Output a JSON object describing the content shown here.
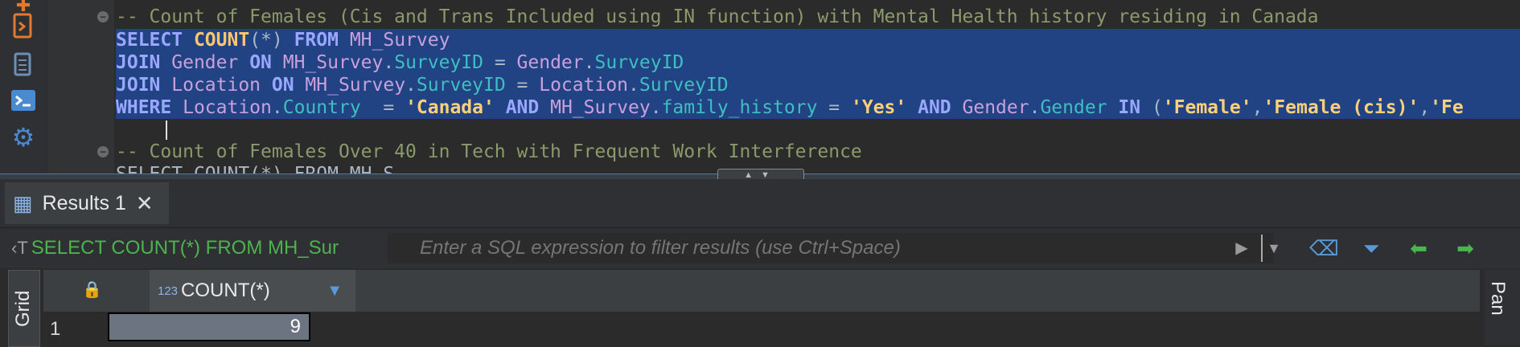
{
  "toolstrip": {
    "icons": [
      "plus-icon",
      "script-icon",
      "outline-icon",
      "console-icon",
      "settings-icon"
    ]
  },
  "editor": {
    "comment1": "-- Count of Females (Cis and Trans Included using IN function) with Mental Health history residing in Canada",
    "line_select": [
      {
        "t": "SELECT ",
        "c": "kwb"
      },
      {
        "t": "COUNT",
        "c": "fn"
      },
      {
        "t": "(*) ",
        "c": "pl"
      },
      {
        "t": "FROM ",
        "c": "kwb"
      },
      {
        "t": "MH_Survey",
        "c": "tbl"
      }
    ],
    "line_join1": [
      {
        "t": "JOIN ",
        "c": "kwb"
      },
      {
        "t": "Gender ",
        "c": "tbl"
      },
      {
        "t": "ON ",
        "c": "kwb"
      },
      {
        "t": "MH_Survey",
        "c": "tbl"
      },
      {
        "t": ".",
        "c": "pl"
      },
      {
        "t": "SurveyID",
        "c": "col"
      },
      {
        "t": " = ",
        "c": "pl"
      },
      {
        "t": "Gender",
        "c": "tbl"
      },
      {
        "t": ".",
        "c": "pl"
      },
      {
        "t": "SurveyID",
        "c": "col"
      }
    ],
    "line_join2": [
      {
        "t": "JOIN ",
        "c": "kwb"
      },
      {
        "t": "Location ",
        "c": "tbl"
      },
      {
        "t": "ON ",
        "c": "kwb"
      },
      {
        "t": "MH_Survey",
        "c": "tbl"
      },
      {
        "t": ".",
        "c": "pl"
      },
      {
        "t": "SurveyID",
        "c": "col"
      },
      {
        "t": " = ",
        "c": "pl"
      },
      {
        "t": "Location",
        "c": "tbl"
      },
      {
        "t": ".",
        "c": "pl"
      },
      {
        "t": "SurveyID",
        "c": "col"
      }
    ],
    "line_where": [
      {
        "t": "WHERE ",
        "c": "kwb"
      },
      {
        "t": "Location",
        "c": "tbl"
      },
      {
        "t": ".",
        "c": "pl"
      },
      {
        "t": "Country",
        "c": "col"
      },
      {
        "t": "  = ",
        "c": "pl"
      },
      {
        "t": "'Canada'",
        "c": "str"
      },
      {
        "t": " AND ",
        "c": "kwb"
      },
      {
        "t": "MH_Survey",
        "c": "tbl"
      },
      {
        "t": ".",
        "c": "pl"
      },
      {
        "t": "family_history",
        "c": "col"
      },
      {
        "t": " = ",
        "c": "pl"
      },
      {
        "t": "'Yes'",
        "c": "str"
      },
      {
        "t": " AND ",
        "c": "kwb"
      },
      {
        "t": "Gender",
        "c": "tbl"
      },
      {
        "t": ".",
        "c": "pl"
      },
      {
        "t": "Gender",
        "c": "col"
      },
      {
        "t": " IN ",
        "c": "kwb"
      },
      {
        "t": "(",
        "c": "pl"
      },
      {
        "t": "'Female'",
        "c": "str"
      },
      {
        "t": ",",
        "c": "pl"
      },
      {
        "t": "'Female (cis)'",
        "c": "str"
      },
      {
        "t": ",",
        "c": "pl"
      },
      {
        "t": "'Fe",
        "c": "str"
      }
    ],
    "comment2": "-- Count of Females Over 40 in Tech with Frequent Work Interference",
    "line_partial": "SELECT COUNT(*) FROM MH_S"
  },
  "results": {
    "tab_label": "Results 1",
    "query_preview": "SELECT COUNT(*) FROM MH_Sur",
    "filter_placeholder": "Enter a SQL expression to filter results (use Ctrl+Space)",
    "grid_tab": "Grid",
    "panels_tab": "Pan",
    "column_type": "123",
    "column_name": "COUNT(*)",
    "row_number": "1",
    "cell_value": "9"
  }
}
